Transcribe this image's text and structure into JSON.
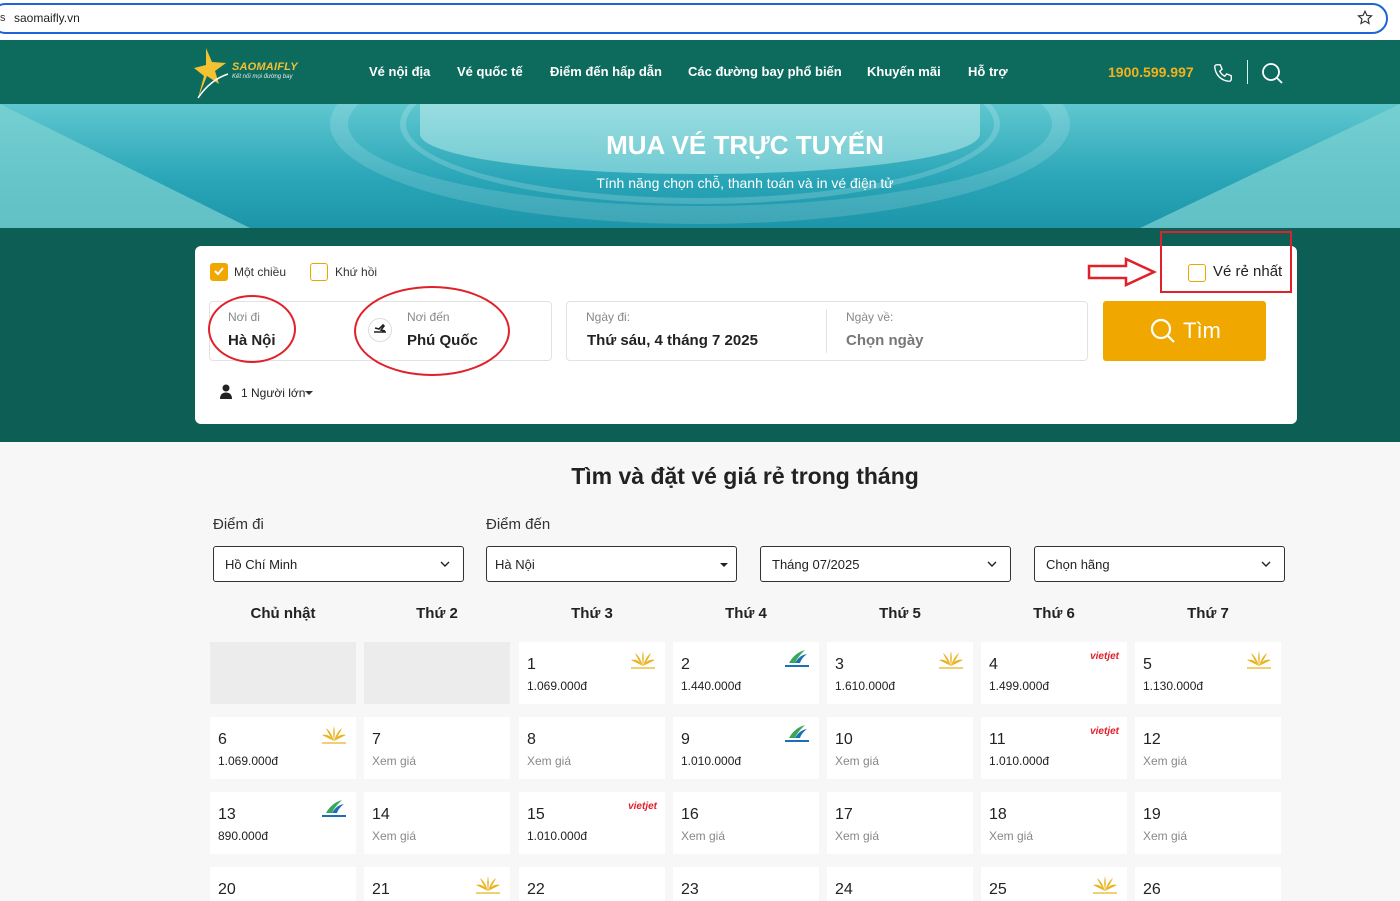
{
  "browser": {
    "url": "saomaifly.vn",
    "left_fragment": "s"
  },
  "nav": {
    "logo_text": "SAOMAIFLY",
    "logo_tagline": "Kết nối mọi đường bay",
    "items": [
      {
        "label": "Vé nội địa"
      },
      {
        "label": "Vé quốc tế"
      },
      {
        "label": "Điểm đến hấp dẫn"
      },
      {
        "label": "Các đường bay phổ biến"
      },
      {
        "label": "Khuyến mãi"
      },
      {
        "label": "Hỗ trợ"
      }
    ],
    "hotline": "1900.599.997"
  },
  "banner": {
    "title": "MUA VÉ TRỰC TUYẾN",
    "subtitle": "Tính năng chọn chỗ, thanh toán và in vé điện tử"
  },
  "search": {
    "one_way_label": "Một chiều",
    "round_trip_label": "Khứ hồi",
    "cheapest_label": "Vé rẻ nhất",
    "origin_label": "Nơi đi",
    "origin_value": "Hà Nội",
    "destination_label": "Nơi đến",
    "destination_value": "Phú Quốc",
    "depart_label": "Ngày đi:",
    "depart_value": "Thứ sáu, 4 tháng 7 2025",
    "return_label": "Ngày về:",
    "return_value": "Chọn ngày",
    "button_label": "Tìm",
    "passengers": "1 Người lớn"
  },
  "calendar": {
    "title": "Tìm và đặt vé giá rẻ trong tháng",
    "from_label": "Điểm đi",
    "to_label": "Điểm đến",
    "from_value": "Hồ Chí Minh",
    "to_value": "Hà Nội",
    "month_value": "Tháng 07/2025",
    "airline_value": "Chọn hãng",
    "weekdays": [
      "Chủ nhật",
      "Thứ 2",
      "Thứ 3",
      "Thứ 4",
      "Thứ 5",
      "Thứ 6",
      "Thứ 7"
    ],
    "no_price": "Xem giá",
    "vietjet_text": "vietjet",
    "rows": [
      [
        {
          "day": "",
          "empty": true
        },
        {
          "day": "",
          "empty": true
        },
        {
          "day": "1",
          "price": "1.069.000đ",
          "airline": "vna"
        },
        {
          "day": "2",
          "price": "1.440.000đ",
          "airline": "bamboo"
        },
        {
          "day": "3",
          "price": "1.610.000đ",
          "airline": "vna"
        },
        {
          "day": "4",
          "price": "1.499.000đ",
          "airline": "vietjet"
        },
        {
          "day": "5",
          "price": "1.130.000đ",
          "airline": "vna"
        }
      ],
      [
        {
          "day": "6",
          "price": "1.069.000đ",
          "airline": "vna"
        },
        {
          "day": "7",
          "price": ""
        },
        {
          "day": "8",
          "price": ""
        },
        {
          "day": "9",
          "price": "1.010.000đ",
          "airline": "bamboo"
        },
        {
          "day": "10",
          "price": ""
        },
        {
          "day": "11",
          "price": "1.010.000đ",
          "airline": "vietjet"
        },
        {
          "day": "12",
          "price": ""
        }
      ],
      [
        {
          "day": "13",
          "price": "890.000đ",
          "airline": "bamboo"
        },
        {
          "day": "14",
          "price": ""
        },
        {
          "day": "15",
          "price": "1.010.000đ",
          "airline": "vietjet"
        },
        {
          "day": "16",
          "price": ""
        },
        {
          "day": "17",
          "price": ""
        },
        {
          "day": "18",
          "price": ""
        },
        {
          "day": "19",
          "price": ""
        }
      ],
      [
        {
          "day": "20",
          "price": ""
        },
        {
          "day": "21",
          "price": "",
          "airline": "vna"
        },
        {
          "day": "22",
          "price": ""
        },
        {
          "day": "23",
          "price": ""
        },
        {
          "day": "24",
          "price": ""
        },
        {
          "day": "25",
          "price": "",
          "airline": "vna"
        },
        {
          "day": "26",
          "price": ""
        }
      ]
    ]
  },
  "colors": {
    "brand_green": "#0d6b5e",
    "accent_orange": "#f0a800",
    "hotline_gold": "#f3b21c",
    "annotation_red": "#e0202a"
  }
}
